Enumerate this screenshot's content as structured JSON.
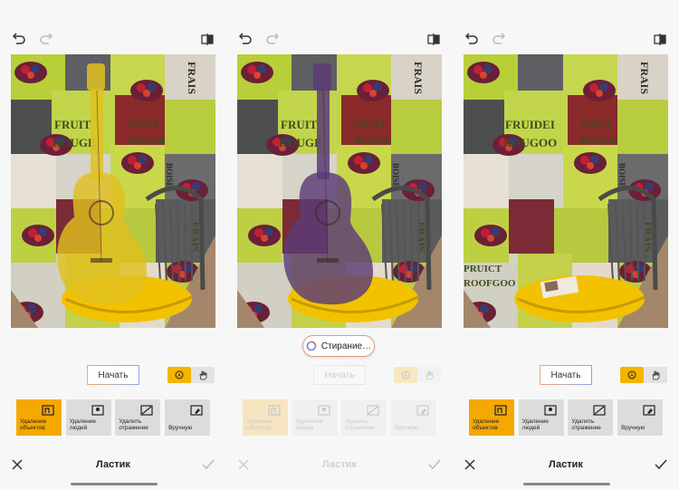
{
  "panels": [
    {
      "tools": [
        {
          "label": "Удаление объектов",
          "icon": "object-icon",
          "selected": true
        },
        {
          "label": "Удаление людей",
          "icon": "person-icon",
          "selected": false
        },
        {
          "label": "Удалить отражение",
          "icon": "reflection-icon",
          "selected": false
        },
        {
          "label": "Вручную",
          "icon": "manual-icon",
          "selected": false
        }
      ],
      "start_label": "Начать",
      "title": "Ластик",
      "guitar_overlay": "#e0c020"
    },
    {
      "status_label": "Стирание…",
      "tools": [
        {
          "label": "Удаление объектов",
          "icon": "object-icon",
          "selected": true
        },
        {
          "label": "Удаление людей",
          "icon": "person-icon",
          "selected": false
        },
        {
          "label": "Удалить отражение",
          "icon": "reflection-icon",
          "selected": false
        },
        {
          "label": "Вручную",
          "icon": "manual-icon",
          "selected": false
        }
      ],
      "start_label": "Начать",
      "title": "Ластик",
      "guitar_overlay": "#5b3c78"
    },
    {
      "tools": [
        {
          "label": "Удаление объектов",
          "icon": "object-icon",
          "selected": true
        },
        {
          "label": "Удаление людей",
          "icon": "person-icon",
          "selected": false
        },
        {
          "label": "Удалить отражение",
          "icon": "reflection-icon",
          "selected": false
        },
        {
          "label": "Вручную",
          "icon": "manual-icon",
          "selected": false
        }
      ],
      "start_label": "Начать",
      "title": "Ластик"
    }
  ],
  "photo_text": {
    "fruit": "FRUIT",
    "rouge": "ROUGE",
    "frais": "FRAIS",
    "fruit3": "FRUIDEI",
    "rouge3": "ROUGOO",
    "fruit3b": "PRUICT",
    "rouge3b": "ROOFGOO",
    "boise": "BOISE"
  },
  "colors": {
    "accent": "#f5a800",
    "chair_seat": "#f2c200"
  }
}
